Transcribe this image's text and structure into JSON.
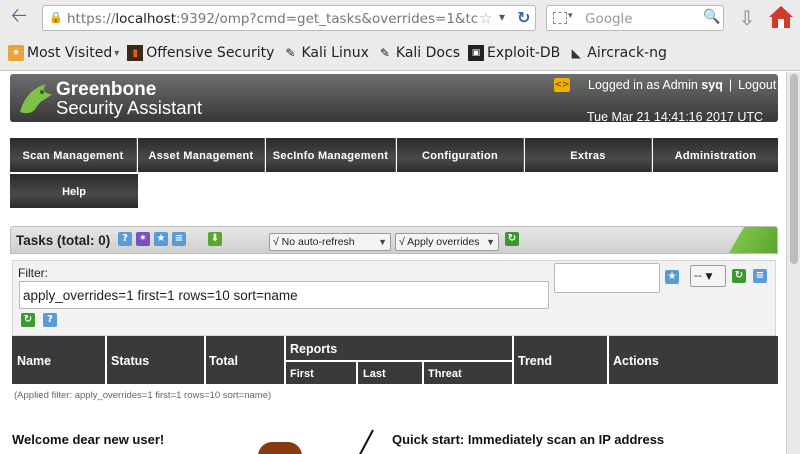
{
  "browser": {
    "url_prefix": "https://",
    "url_host": "localhost",
    "url_rest": ":9392/omp?cmd=get_tasks&overrides=1&tc",
    "search_placeholder": "Google",
    "bookmarks": [
      {
        "label": "Most Visited",
        "icon": "star-icon"
      },
      {
        "label": "Offensive Security",
        "icon": "offsec-icon"
      },
      {
        "label": "Kali Linux",
        "icon": "kali-dragon-icon"
      },
      {
        "label": "Kali Docs",
        "icon": "kali-dragon-icon"
      },
      {
        "label": "Exploit-DB",
        "icon": "exploitdb-icon"
      },
      {
        "label": "Aircrack-ng",
        "icon": "aircrack-icon"
      }
    ]
  },
  "header": {
    "brand_line1": "Greenbone",
    "brand_line2": "Security Assistant",
    "lang_badge": "<>",
    "logged_in_prefix": "Logged in as Admin",
    "username": "syq",
    "logout_label": "Logout",
    "datetime": "Tue Mar 21 14:41:16 2017 UTC"
  },
  "menu": {
    "items": [
      {
        "label": "Scan Management"
      },
      {
        "label": "Asset Management"
      },
      {
        "label": "SecInfo Management"
      },
      {
        "label": "Configuration"
      },
      {
        "label": "Extras"
      },
      {
        "label": "Administration"
      }
    ],
    "help_label": "Help"
  },
  "tasks": {
    "title": "Tasks (total: 0)",
    "refresh_select": "√ No auto-refresh",
    "overrides_select": "√ Apply overrides",
    "icon_colors": {
      "help": "#5b9bd5",
      "wizard": "#7a4fbf",
      "new": "#5b9bd5",
      "list": "#5b9bd5",
      "download": "#5aa52e",
      "refresh": "#3b9a2e"
    }
  },
  "filter": {
    "label": "Filter:",
    "value": "apply_overrides=1 first=1 rows=10 sort=name",
    "filter_select": "--"
  },
  "table": {
    "columns": {
      "name": "Name",
      "status": "Status",
      "total": "Total",
      "reports": "Reports",
      "first": "First",
      "last": "Last",
      "threat": "Threat",
      "trend": "Trend",
      "actions": "Actions"
    },
    "applied_filter": "(Applied filter: apply_overrides=1 first=1 rows=10 sort=name)"
  },
  "welcome": {
    "greeting": "Welcome dear new user!",
    "quickstart": "Quick start: Immediately scan an IP address"
  }
}
